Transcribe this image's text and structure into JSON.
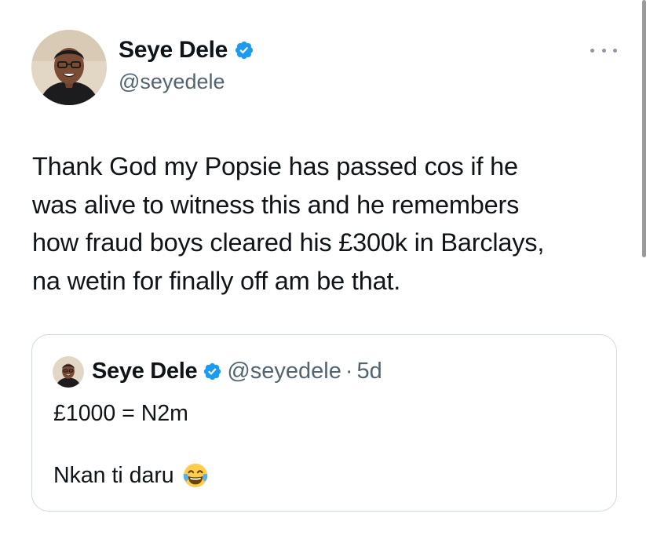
{
  "author": {
    "name": "Seye Dele",
    "handle": "@seyedele",
    "verified": true
  },
  "tweet": {
    "lines": [
      "Thank God my Popsie has passed cos if he",
      "was alive to witness this and he remembers",
      "how fraud boys cleared his £300k in Barclays,",
      "na wetin for finally off am be that."
    ]
  },
  "quoted_tweet": {
    "name": "Seye Dele",
    "handle": "@seyedele",
    "separator": "·",
    "age": "5d",
    "line1": "£1000 = N2m",
    "line2": "Nkan ti daru",
    "emoji": "face-with-tears-of-joy"
  },
  "icons": {
    "verified": "verified-badge-icon",
    "more": "more-options-icon"
  },
  "colors": {
    "verified_blue": "#1d9bf0",
    "text": "#0f1419",
    "secondary_text": "#536471",
    "border": "#cfd9de"
  }
}
